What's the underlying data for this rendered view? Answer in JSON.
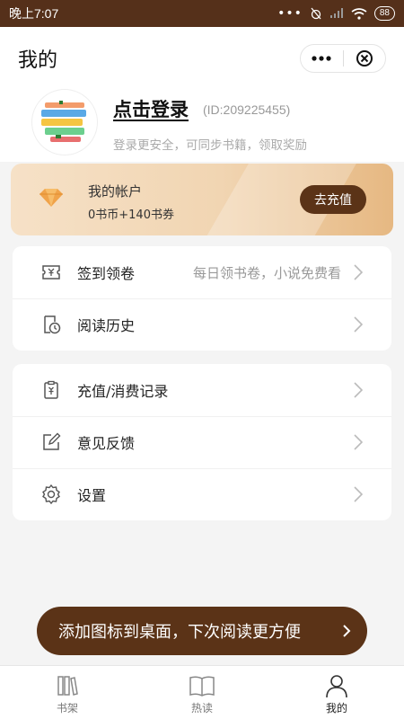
{
  "status_bar": {
    "time": "晚上7:07",
    "battery": "88"
  },
  "header": {
    "title": "我的"
  },
  "profile": {
    "login_label": "点击登录",
    "user_id": "(ID:209225455)",
    "subtitle": "登录更安全，可同步书籍，领取奖励"
  },
  "account": {
    "title": "我的帐户",
    "balance": "0书币+140书券",
    "recharge_label": "去充值"
  },
  "menu_group_1": [
    {
      "label": "签到领卷",
      "hint": "每日领书卷，小说免费看",
      "icon": "ticket-icon"
    },
    {
      "label": "阅读历史",
      "icon": "history-icon"
    }
  ],
  "menu_group_2": [
    {
      "label": "充值/消费记录",
      "icon": "receipt-icon"
    },
    {
      "label": "意见反馈",
      "icon": "edit-icon"
    },
    {
      "label": "设置",
      "icon": "gear-icon"
    }
  ],
  "banner": {
    "text": "添加图标到桌面，下次阅读更方便"
  },
  "tabbar": {
    "tabs": [
      {
        "label": "书架",
        "icon": "bookshelf-icon",
        "active": false
      },
      {
        "label": "热读",
        "icon": "open-book-icon",
        "active": false
      },
      {
        "label": "我的",
        "icon": "person-icon",
        "active": true
      }
    ]
  },
  "colors": {
    "accent": "#5b3317",
    "gold": "#e6b882"
  }
}
